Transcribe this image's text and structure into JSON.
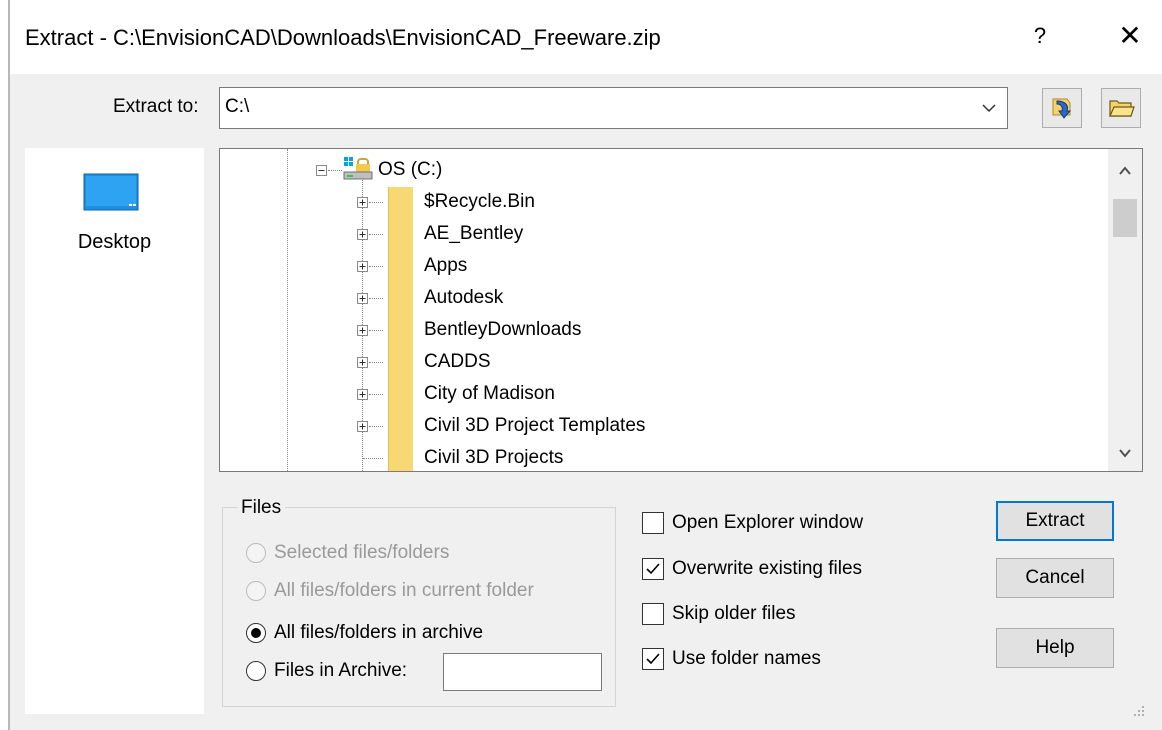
{
  "window": {
    "title": "Extract - C:\\EnvisionCAD\\Downloads\\EnvisionCAD_Freeware.zip",
    "help_glyph": "?",
    "close_glyph": "✕"
  },
  "extract_to": {
    "label": "Extract to:",
    "value": "C:\\"
  },
  "toolbar": {
    "icons": [
      "jump-to-folder-icon",
      "browse-folder-icon"
    ]
  },
  "sidebar": {
    "desktop_label": "Desktop"
  },
  "tree": {
    "root_label": "OS (C:)",
    "items": [
      "$Recycle.Bin",
      "AE_Bentley",
      "Apps",
      "Autodesk",
      "BentleyDownloads",
      "CADDS",
      "City of Madison",
      "Civil 3D Project Templates",
      "Civil 3D Projects"
    ]
  },
  "files_group": {
    "title": "Files",
    "options": [
      {
        "label": "Selected files/folders",
        "enabled": false,
        "checked": false
      },
      {
        "label": "All files/folders in current folder",
        "enabled": false,
        "checked": false
      },
      {
        "label": "All files/folders in archive",
        "enabled": true,
        "checked": true
      },
      {
        "label": "Files in Archive:",
        "enabled": true,
        "checked": false
      }
    ],
    "files_in_archive_value": ""
  },
  "options": [
    {
      "label": "Open Explorer window",
      "checked": false
    },
    {
      "label": "Overwrite existing files",
      "checked": true
    },
    {
      "label": "Skip older files",
      "checked": false
    },
    {
      "label": "Use folder names",
      "checked": true
    }
  ],
  "buttons": {
    "extract": "Extract",
    "cancel": "Cancel",
    "help": "Help"
  },
  "colors": {
    "default_button_border": "#0078d7",
    "folder": "#f8d775",
    "desktop_icon": "#1e90e0"
  }
}
